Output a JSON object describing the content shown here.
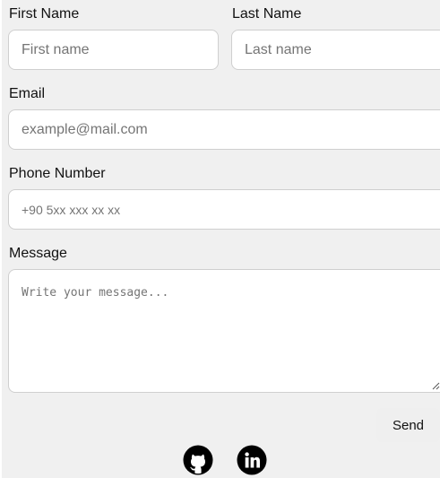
{
  "form": {
    "first_name": {
      "label": "First Name",
      "placeholder": "First name",
      "value": ""
    },
    "last_name": {
      "label": "Last Name",
      "placeholder": "Last name",
      "value": ""
    },
    "email": {
      "label": "Email",
      "placeholder": "example@mail.com",
      "value": ""
    },
    "phone": {
      "label": "Phone Number",
      "placeholder": "+90 5xx xxx xx xx",
      "value": ""
    },
    "message": {
      "label": "Message",
      "placeholder": "Write your message...",
      "value": ""
    },
    "send_label": "Send"
  },
  "social": [
    {
      "name": "github",
      "icon": "github-icon",
      "color": "#000000"
    },
    {
      "name": "linkedin",
      "icon": "linkedin-icon",
      "color": "#000000"
    }
  ]
}
